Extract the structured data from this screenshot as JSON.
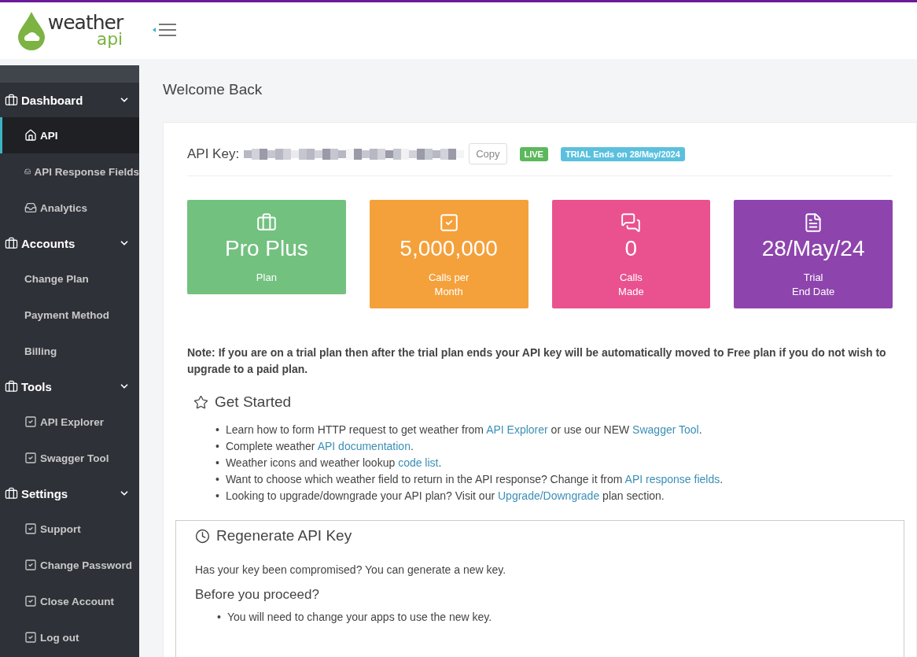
{
  "logo": {
    "word": "weather",
    "sub": "api"
  },
  "sidebar": {
    "sections": [
      {
        "label": "Dashboard",
        "expanded": true,
        "items": [
          {
            "label": "API",
            "kind": "home",
            "selected": true
          },
          {
            "label": "API Response Fields",
            "kind": "inbox",
            "selected": false
          },
          {
            "label": "Analytics",
            "kind": "inbox",
            "selected": false
          }
        ]
      },
      {
        "label": "Accounts",
        "expanded": true,
        "items": [
          {
            "label": "Change Plan",
            "kind": "plain",
            "selected": false
          },
          {
            "label": "Payment Method",
            "kind": "plain",
            "selected": false
          },
          {
            "label": "Billing",
            "kind": "plain",
            "selected": false
          }
        ]
      },
      {
        "label": "Tools",
        "expanded": true,
        "items": [
          {
            "label": "API Explorer",
            "kind": "check",
            "selected": false
          },
          {
            "label": "Swagger Tool",
            "kind": "check",
            "selected": false
          }
        ]
      },
      {
        "label": "Settings",
        "expanded": true,
        "items": [
          {
            "label": "Support",
            "kind": "check",
            "selected": false
          },
          {
            "label": "Change Password",
            "kind": "check",
            "selected": false
          },
          {
            "label": "Close Account",
            "kind": "check",
            "selected": false
          },
          {
            "label": "Log out",
            "kind": "check",
            "selected": false
          }
        ]
      }
    ]
  },
  "page_title": "Welcome Back",
  "api_key": {
    "label": "API Key:",
    "copy_button": "Copy",
    "badges": [
      {
        "text": "LIVE",
        "color": "#5cb85c"
      },
      {
        "text": "TRIAL Ends on 28/May/2024",
        "color": "#5bc0de"
      }
    ]
  },
  "stats": [
    {
      "kind": "briefcase",
      "value": "Pro Plus",
      "label": [
        "Plan"
      ],
      "color": "#72c17f"
    },
    {
      "kind": "check",
      "value": "5,000,000",
      "label": [
        "Calls per",
        "Month"
      ],
      "color": "#f4a13b"
    },
    {
      "kind": "chat",
      "value": "0",
      "label": [
        "Calls",
        "Made"
      ],
      "color": "#e9528f"
    },
    {
      "kind": "document",
      "value": "28/May/24",
      "label": [
        "Trial",
        "End Date"
      ],
      "color": "#8e44ad"
    }
  ],
  "note": "Note: If you are on a trial plan then after the trial plan ends your API key will be automatically moved to Free plan if you do not wish to upgrade to a paid plan.",
  "get_started": {
    "title": "Get Started",
    "items": [
      {
        "bullet": "•",
        "segments": [
          {
            "kind": "text",
            "text": "Learn how to form HTTP request to get weather from "
          },
          {
            "kind": "link",
            "text": "API Explorer"
          },
          {
            "kind": "text",
            "text": " or use our NEW "
          },
          {
            "kind": "link",
            "text": "Swagger Tool"
          },
          {
            "kind": "text",
            "text": "."
          }
        ]
      },
      {
        "bullet": "•",
        "segments": [
          {
            "kind": "text",
            "text": "Complete weather "
          },
          {
            "kind": "link",
            "text": "API documentation"
          },
          {
            "kind": "text",
            "text": "."
          }
        ]
      },
      {
        "bullet": "•",
        "segments": [
          {
            "kind": "text",
            "text": "Weather icons and weather lookup "
          },
          {
            "kind": "link",
            "text": "code list"
          },
          {
            "kind": "text",
            "text": "."
          }
        ]
      },
      {
        "bullet": "•",
        "segments": [
          {
            "kind": "text",
            "text": "Want to choose which weather field to return in the API response? Change it from "
          },
          {
            "kind": "link",
            "text": "API response fields"
          },
          {
            "kind": "text",
            "text": "."
          }
        ]
      },
      {
        "bullet": "•",
        "segments": [
          {
            "kind": "text",
            "text": "Looking to upgrade/downgrade your API plan? Visit our "
          },
          {
            "kind": "link",
            "text": "Upgrade/Downgrade"
          },
          {
            "kind": "text",
            "text": " plan section."
          }
        ]
      }
    ]
  },
  "regenerate": {
    "title": "Regenerate API Key",
    "text": "Has your key been compromised? You can generate a new key.",
    "subtitle": "Before you proceed?",
    "items": [
      {
        "bullet": "•",
        "text": "You will need to change your apps to use the new key."
      }
    ]
  }
}
